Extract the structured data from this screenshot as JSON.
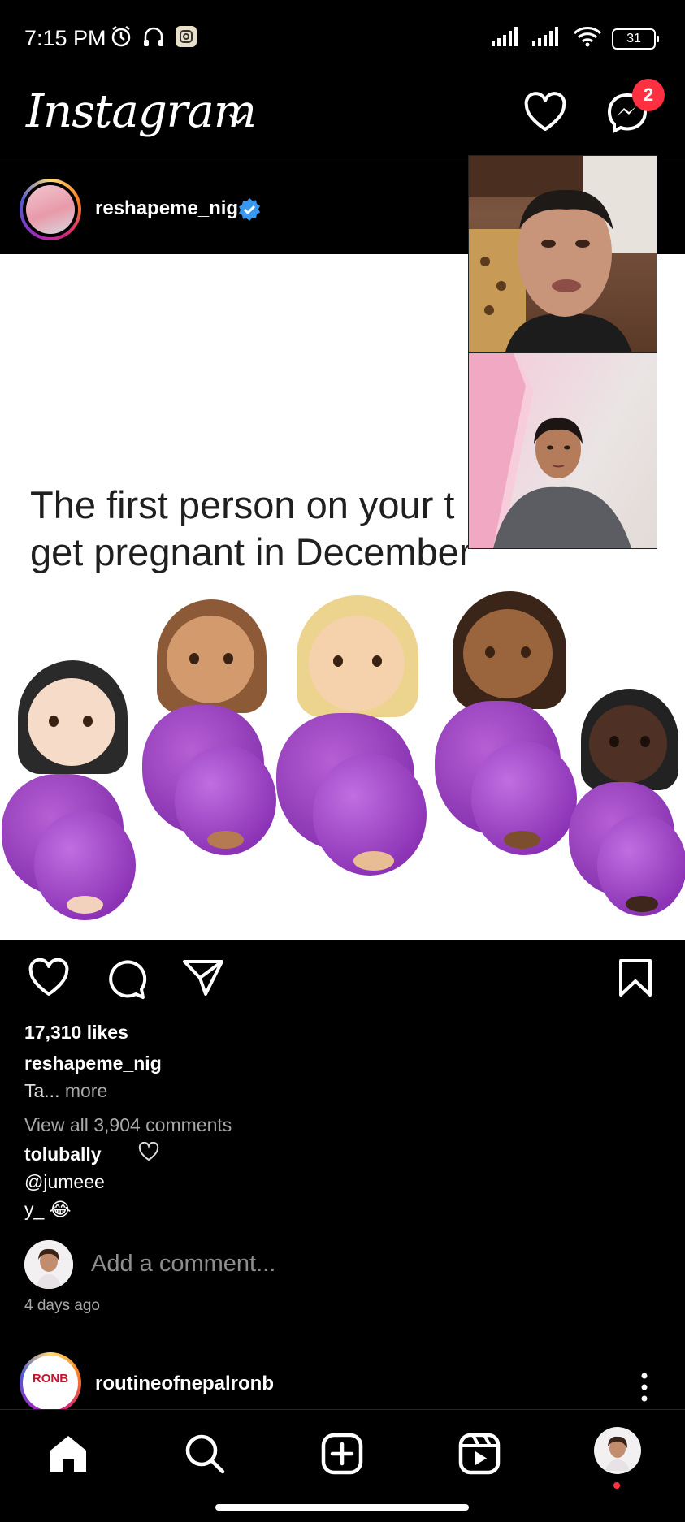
{
  "status_bar": {
    "time": "7:15 PM",
    "battery": "31",
    "icons_left": [
      "alarm-icon",
      "headphones-icon",
      "instagram-notification-icon"
    ],
    "icons_right": [
      "signal-icon",
      "signal-icon",
      "wifi-icon",
      "battery-icon"
    ]
  },
  "header": {
    "logo_text": "Instagram",
    "messenger_badge": "2"
  },
  "post": {
    "username": "reshapeme_nig",
    "verified": true,
    "image_text_line1": "The first person on your t",
    "image_text_line2": "get pregnant in December",
    "likes": "17,310 likes",
    "caption_username": "reshapeme_nig",
    "caption_text": "Ta...",
    "caption_more": " more",
    "view_all_comments": "View all 3,904 comments",
    "comment_username": "tolubally",
    "comment_line1": "@jumeee",
    "comment_line2": "y_ 😂",
    "add_comment_placeholder": "Add a comment...",
    "time_ago": "4 days ago"
  },
  "next_post": {
    "username": "routineofnepalronb",
    "avatar_text": "RONB"
  },
  "bottom_nav": [
    "home-icon",
    "search-icon",
    "create-post-icon",
    "reels-icon",
    "profile-avatar"
  ],
  "colors": {
    "background": "#000000",
    "badge": "#ff3040",
    "verified": "#3897f0",
    "muted_text": "#a8a8a8",
    "emoji_purple": "#8a35b2"
  }
}
